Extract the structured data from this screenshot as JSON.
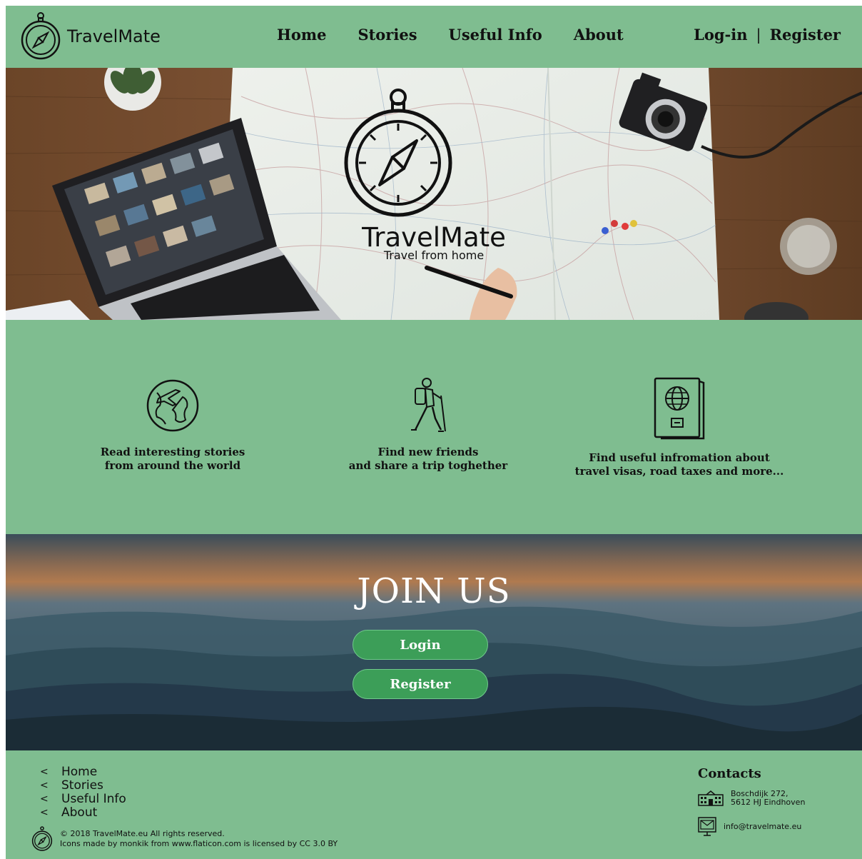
{
  "header": {
    "brand": "TravelMate",
    "nav": [
      "Home",
      "Stories",
      "Useful Info",
      "About"
    ],
    "login": "Log-in",
    "separator": "|",
    "register": "Register"
  },
  "hero": {
    "title": "TravelMate",
    "tagline": "Travel from home"
  },
  "features": [
    {
      "icon": "globe-plane-icon",
      "text": "Read interesting stories\nfrom around the world"
    },
    {
      "icon": "hiker-icon",
      "text": "Find new friends\nand share a trip toghether"
    },
    {
      "icon": "passport-icon",
      "text": "Find useful infromation about\ntravel visas, road taxes and more..."
    }
  ],
  "join": {
    "title": "JOIN US",
    "login_label": "Login",
    "register_label": "Register"
  },
  "footer": {
    "nav": [
      "Home",
      "Stories",
      "Useful Info",
      "About"
    ],
    "copyright_line1": "© 2018 TravelMate.eu All rights reserved.",
    "copyright_line2": "Icons made by  monkik from www.flaticon.com is licensed by  CC 3.0 BY",
    "contacts_title": "Contacts",
    "address": "Boschdijk 272,\n5612 HJ Eindhoven",
    "email": "info@travelmate.eu"
  },
  "colors": {
    "brand_green": "#7fbd90",
    "button_green": "#3c9e58"
  }
}
